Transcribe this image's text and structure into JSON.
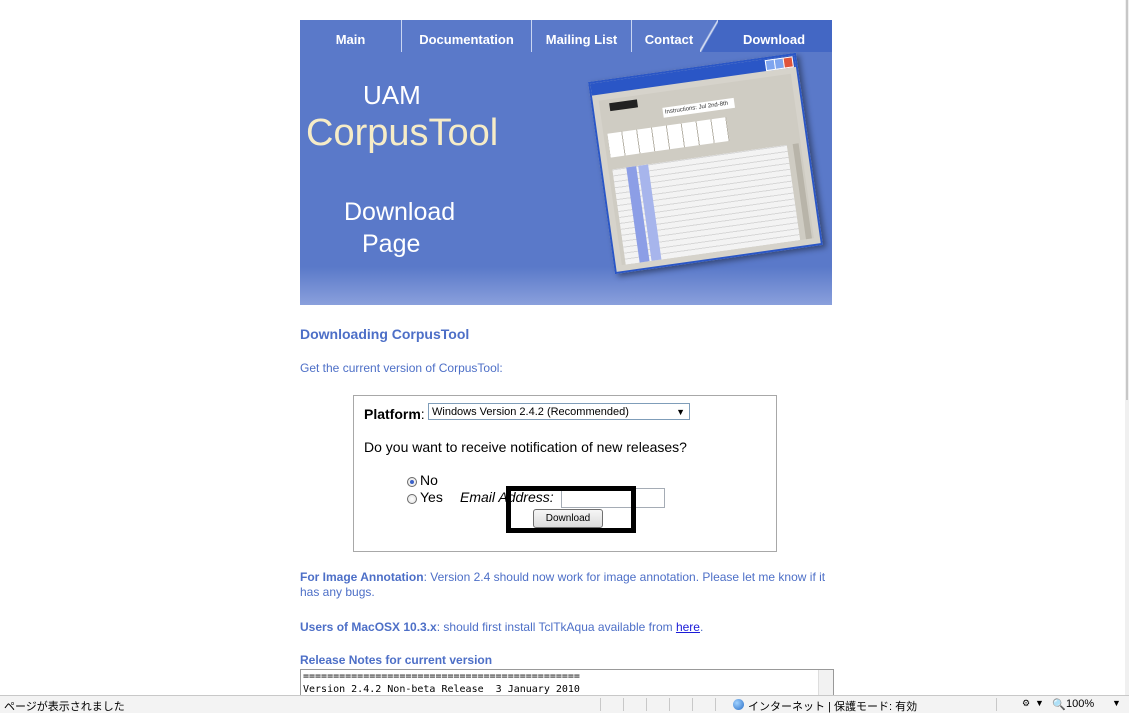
{
  "nav": {
    "tabs": [
      "Main",
      "Documentation",
      "Mailing List",
      "Contact",
      "Download"
    ]
  },
  "hero": {
    "uam": "UAM",
    "corpustool": "CorpusTool",
    "download": "Download",
    "page": "Page",
    "screenshot_instructions": "Instructions: Jul 2nd-8th"
  },
  "content": {
    "heading": "Downloading CorpusTool",
    "intro": "Get the current version of CorpusTool:",
    "form": {
      "platform_label": "Platform",
      "platform_value": "Windows Version 2.4.2 (Recommended)",
      "question": "Do you want to receive notification of new releases?",
      "option_no": "No",
      "option_yes": "Yes",
      "email_label": "Email Address:",
      "email_value": "",
      "download_button": "Download"
    },
    "image_annotation_lead": "For Image Annotation",
    "image_annotation_text": ": Version 2.4 should now work for image annotation. Please let me know if it has any bugs.",
    "macosx_lead": "Users of MacOSX 10.3.x",
    "macosx_text": ": should first install TclTkAqua available from ",
    "macosx_link": "here",
    "release_heading": "Release Notes for current version",
    "release_lines": "==============================================\nVersion 2.4.2 Non-beta Release  3 January 2010"
  },
  "status_bar": {
    "left": "ページが表示されました",
    "zone": "インターネット | 保護モード: 有効",
    "zoom": "100%"
  },
  "colors": {
    "nav_bg": "#5a79c9",
    "hero_bg": "#5a79c9",
    "heading_blue": "#4d6fc7",
    "corpustool_cream": "#f6ecc7"
  }
}
